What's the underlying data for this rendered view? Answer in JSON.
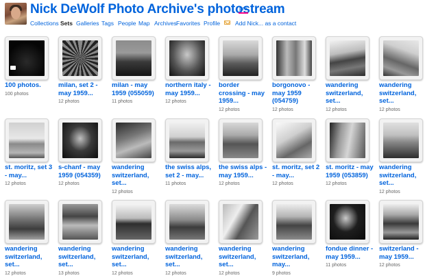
{
  "header": {
    "title": "Nick DeWolf Photo Archive's photostream",
    "pro_label": "pro",
    "nav": [
      {
        "label": "Collections",
        "active": false
      },
      {
        "label": "Sets",
        "active": true
      },
      {
        "label": "Galleries",
        "active": false
      },
      {
        "label": "Tags",
        "active": false
      },
      {
        "label": "People",
        "active": false
      },
      {
        "label": "Map",
        "active": false
      },
      {
        "label": "Archives",
        "active": false
      },
      {
        "label": "Favorites",
        "active": false
      },
      {
        "label": "Profile",
        "active": false
      }
    ],
    "add_contact_label": "Add Nick... as a contact"
  },
  "sets": [
    {
      "name": [
        "100 photos."
      ],
      "count": "100 photos"
    },
    {
      "name": [
        "milan, set 2 -",
        "may 1959..."
      ],
      "count": "12 photos"
    },
    {
      "name": [
        "milan - may",
        "1959 (055059)"
      ],
      "count": "11 photos"
    },
    {
      "name": [
        "northern italy -",
        "may 1959..."
      ],
      "count": "12 photos"
    },
    {
      "name": [
        "border",
        "crossing - may",
        "1959..."
      ],
      "count": "12 photos"
    },
    {
      "name": [
        "borgonovo -",
        "may 1959",
        "(054759)"
      ],
      "count": "12 photos"
    },
    {
      "name": [
        "wandering",
        "switzerland,",
        "set..."
      ],
      "count": "12 photos"
    },
    {
      "name": [
        "wandering",
        "switzerland,",
        "set..."
      ],
      "count": "12 photos"
    },
    {
      "name": [
        "st. moritz, set 3",
        "- may..."
      ],
      "count": "12 photos"
    },
    {
      "name": [
        "s-chanf - may",
        "1959 (054359)"
      ],
      "count": "12 photos"
    },
    {
      "name": [
        "wandering",
        "switzerland,",
        "set..."
      ],
      "count": "12 photos"
    },
    {
      "name": [
        "the swiss alps,",
        "set 2 - may..."
      ],
      "count": "11 photos"
    },
    {
      "name": [
        "the swiss alps -",
        "may 1959..."
      ],
      "count": "12 photos"
    },
    {
      "name": [
        "st. moritz, set 2",
        "- may..."
      ],
      "count": "12 photos"
    },
    {
      "name": [
        "st. moritz - may",
        "1959 (053859)"
      ],
      "count": "12 photos"
    },
    {
      "name": [
        "wandering",
        "switzerland,",
        "set..."
      ],
      "count": "12 photos"
    },
    {
      "name": [
        "wandering",
        "switzerland,",
        "set..."
      ],
      "count": "12 photos"
    },
    {
      "name": [
        "wandering",
        "switzerland,",
        "set..."
      ],
      "count": "13 photos"
    },
    {
      "name": [
        "wandering",
        "switzerland,",
        "set..."
      ],
      "count": "12 photos"
    },
    {
      "name": [
        "wandering",
        "switzerland,",
        "set..."
      ],
      "count": "12 photos"
    },
    {
      "name": [
        "wandering",
        "switzerland,",
        "set..."
      ],
      "count": "12 photos"
    },
    {
      "name": [
        "wandering",
        "switzerland,",
        "may..."
      ],
      "count": "9 photos"
    },
    {
      "name": [
        "fondue dinner -",
        "may 1959..."
      ],
      "count": "11 photos"
    },
    {
      "name": [
        "switzerland -",
        "may 1959..."
      ],
      "count": "12 photos"
    }
  ]
}
